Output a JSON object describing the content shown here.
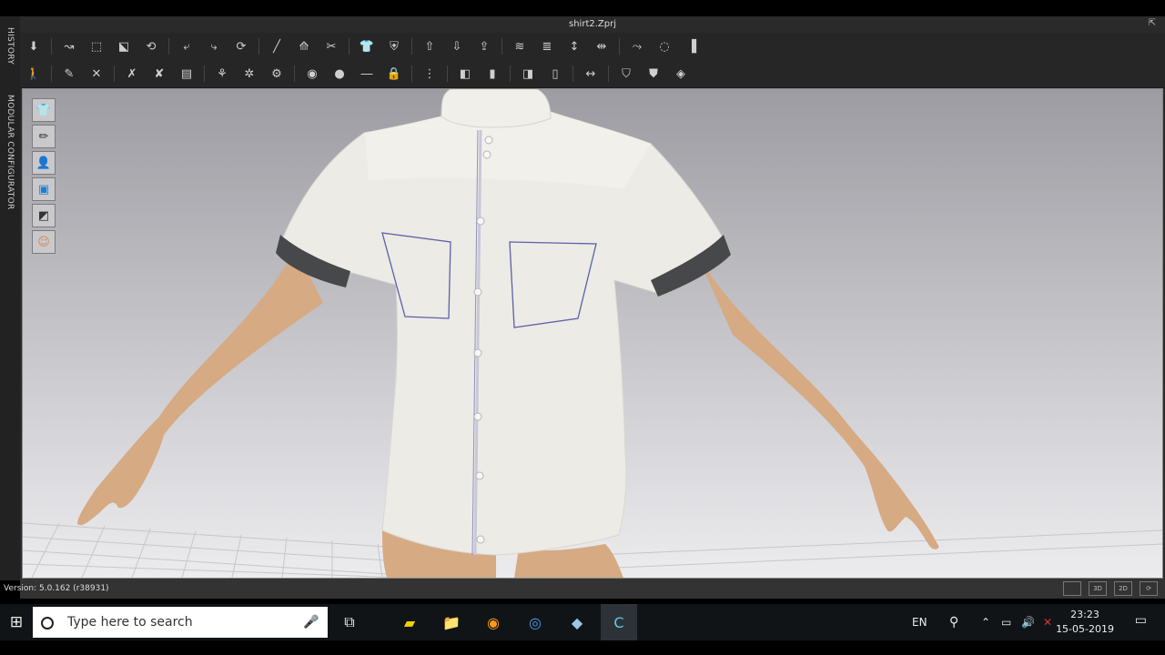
{
  "window": {
    "title": "shirt2.Zprj",
    "restore_icon": "restore-icon"
  },
  "side_tabs": {
    "history": "HISTORY",
    "modular_configurator": "MODULAR CONFIGURATOR"
  },
  "toolbar": {
    "row1": [
      "simulation-icon",
      "select-move-icon",
      "select-mesh-icon",
      "transform-pattern-icon",
      "fold-arrangement-icon",
      "fold-icon",
      "unfold-icon",
      "reset-2d-icon",
      "tack-icon",
      "fold-up-icon",
      "remove-tack-icon",
      "shirt-front-icon",
      "shirt-back-icon",
      "avatar-arrange-icon",
      "arrangement-point-icon",
      "strengthen-icon",
      "reset-arrangement-icon",
      "lines-icon",
      "pin-icon",
      "circle-pin-icon",
      "cut-icon",
      "ruler-icon"
    ],
    "row2": [
      "avatar-icon",
      "brush-icon",
      "sew-icon",
      "segment-sew-icon",
      "free-sew-icon",
      "measure-icon",
      "edit-sew-icon",
      "button-icon",
      "buttonhole-icon",
      "select-button-icon",
      "line-icon",
      "zipper-icon",
      "puckering-icon",
      "tape-icon",
      "topstitch-icon",
      "elastic-icon",
      "cut-line-icon",
      "pleat-icon",
      "fold-line-icon",
      "fabric-icon",
      "garment-icon",
      "fit-icon"
    ]
  },
  "viewport_tools": [
    {
      "name": "garment-view-icon",
      "glyph": "👕"
    },
    {
      "name": "texture-view-icon",
      "glyph": "✏"
    },
    {
      "name": "avatar-view-icon",
      "glyph": "👤"
    },
    {
      "name": "surface-view-icon",
      "glyph": "▣"
    },
    {
      "name": "shading-view-icon",
      "glyph": "◩"
    },
    {
      "name": "avatar-skin-icon",
      "glyph": "☺"
    }
  ],
  "status": {
    "version": "Version: 5.0.162 (r38931)",
    "view_buttons": [
      "",
      "3D",
      "2D",
      "⟳"
    ]
  },
  "taskbar": {
    "search_placeholder": "Type here to search",
    "language": "EN",
    "time": "23:23",
    "date": "15-05-2019",
    "apps": [
      {
        "name": "task-view-icon",
        "glyph": "⧉"
      },
      {
        "name": "sticky-notes-icon",
        "glyph": "▰"
      },
      {
        "name": "file-explorer-icon",
        "glyph": "📁"
      },
      {
        "name": "uc-browser-icon",
        "glyph": "◉"
      },
      {
        "name": "chrome-icon",
        "glyph": "◎"
      },
      {
        "name": "app-icon",
        "glyph": "◆"
      },
      {
        "name": "clo3d-icon",
        "glyph": "C"
      }
    ]
  },
  "colors": {
    "shirt": "#ecebe5",
    "cuff": "#474849",
    "skin": "#d9ad87",
    "pocket_line": "#5d5fa8"
  }
}
